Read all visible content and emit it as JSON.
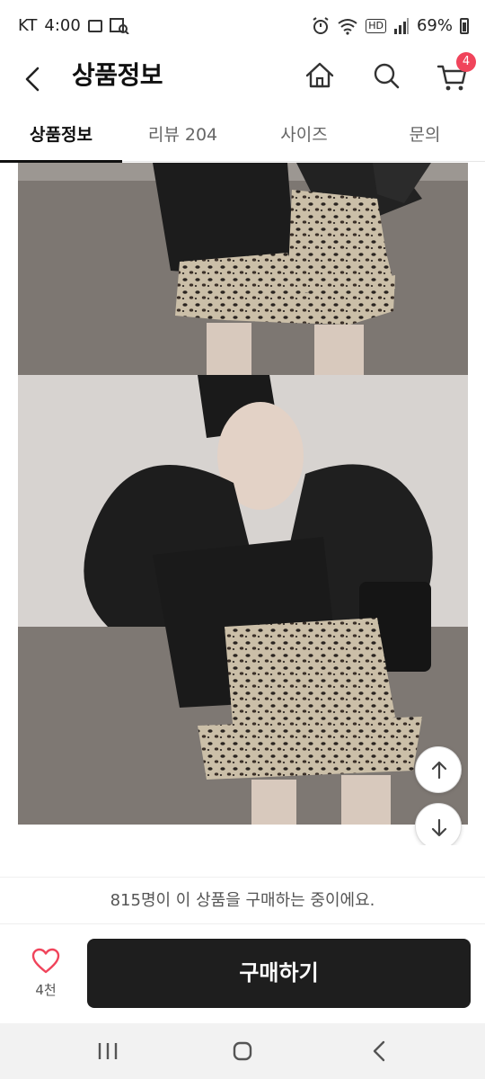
{
  "status_bar": {
    "carrier": "KT",
    "time": "4:00",
    "hd_label": "HD",
    "battery": "69%"
  },
  "header": {
    "title": "상품정보",
    "cart_count": "4"
  },
  "tabs": [
    {
      "label": "상품정보",
      "active": true
    },
    {
      "label": "리뷰 204",
      "active": false
    },
    {
      "label": "사이즈",
      "active": false
    },
    {
      "label": "문의",
      "active": false
    }
  ],
  "notice": {
    "text": "815명이 이 상품을 구매하는 중이에요."
  },
  "bottom_bar": {
    "like_count": "4천",
    "buy_label": "구매하기"
  },
  "colors": {
    "accent": "#f0445b",
    "buy_button": "#1e1e1e",
    "active_tab": "#111111"
  },
  "icons": {
    "back": "chevron-left-icon",
    "home": "home-icon",
    "search": "search-icon",
    "cart": "cart-icon",
    "scroll_up": "arrow-up-icon",
    "scroll_down": "arrow-down-icon",
    "like": "heart-icon"
  }
}
